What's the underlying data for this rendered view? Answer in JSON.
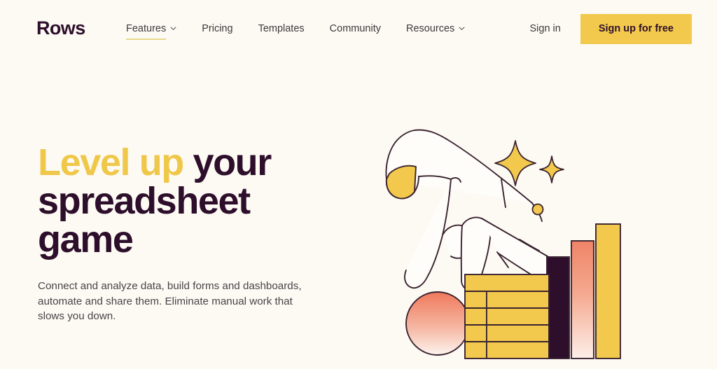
{
  "brand": {
    "name": "Rows"
  },
  "nav": {
    "items": [
      {
        "label": "Features",
        "icon": "chevron-down-icon",
        "has_caret": true,
        "active": true
      },
      {
        "label": "Pricing",
        "icon": "",
        "has_caret": false,
        "active": false
      },
      {
        "label": "Templates",
        "icon": "",
        "has_caret": false,
        "active": false
      },
      {
        "label": "Community",
        "icon": "",
        "has_caret": false,
        "active": false
      },
      {
        "label": "Resources",
        "icon": "chevron-down-icon",
        "has_caret": true,
        "active": false
      }
    ],
    "sign_in": "Sign in",
    "sign_up": "Sign up for free"
  },
  "hero": {
    "headline_highlight": "Level up ",
    "headline_rest": "your spreadsheet game",
    "subcopy": "Connect and analyze data, build forms and dashboards, automate and share them. Eliminate manual work that slows you down."
  },
  "illustration": {
    "name": "hand-pointing-at-spreadsheet-and-bar-chart",
    "elements": [
      "hand-icon",
      "thumb-nail",
      "sparkle-large-icon",
      "sparkle-small-icon",
      "coin-icon",
      "gradient-circle",
      "spreadsheet-grid",
      "bar-dark",
      "bar-coral-gradient",
      "bar-yellow"
    ]
  },
  "colors": {
    "background": "#FDFAF4",
    "brand_dark": "#2E0F2B",
    "accent_yellow": "#F2C94C",
    "headline_yellow": "#EFC84A",
    "coral": "#F08A6E",
    "nav_text": "#3C3A3C",
    "underline": "#E8D98C",
    "outline": "#3A2330"
  }
}
